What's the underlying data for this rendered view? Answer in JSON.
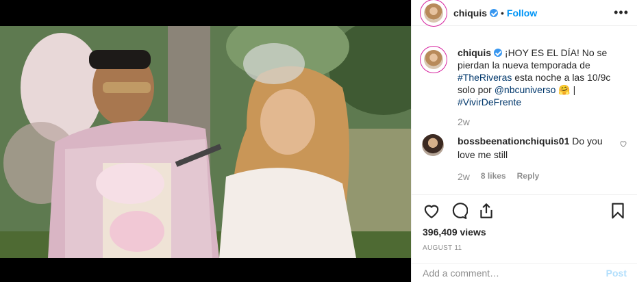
{
  "post": {
    "username": "chiquis",
    "follow_label": "Follow",
    "separator": "•",
    "more_label": "•••"
  },
  "caption": {
    "username": "chiquis",
    "text_1": "¡HOY ES EL DÍA! No se pierdan la nueva temporada de ",
    "hashtag_1": "#TheRiveras",
    "text_2": " esta noche a las 10/9c solo por ",
    "mention": "@nbcuniverso",
    "emoji": "🤗",
    "text_3": " | ",
    "hashtag_2": "#VivirDeFrente",
    "time": "2w"
  },
  "comment": {
    "username": "bossbeenationchiquis01",
    "text": "Do you love me still",
    "time": "2w",
    "likes": "8 likes",
    "reply_label": "Reply"
  },
  "stats": {
    "views": "396,409 views",
    "date": "AUGUST 11"
  },
  "add_comment": {
    "placeholder": "Add a comment…",
    "post_label": "Post"
  },
  "icons": {
    "like": "heart-icon",
    "comment": "comment-icon",
    "share": "share-icon",
    "save": "bookmark-icon",
    "verified": "verified-badge-icon"
  },
  "colors": {
    "link": "#00376b",
    "follow": "#0095f6",
    "verified": "#3897f0",
    "muted": "#8e8e8e"
  }
}
